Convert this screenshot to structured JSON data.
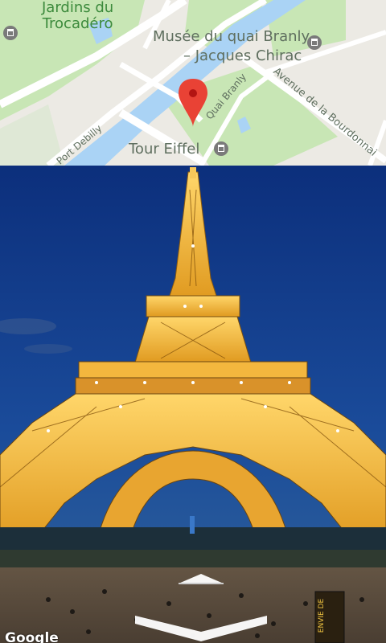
{
  "map": {
    "labels": {
      "jardins": "Jardins du\nTrocadéro",
      "musee_line1": "Musée du quai Branly",
      "musee_line2": "– Jacques Chirac",
      "tour": "Tour Eiffel",
      "quai": "Quai Branly",
      "avenue": "Avenue de la Bourdonnai",
      "port": "Port Debilly"
    },
    "colors": {
      "park": "#c8e6b5",
      "water": "#aad3f5",
      "road": "#ffffff",
      "land": "#eceae4",
      "pin": "#e94235"
    },
    "icons": [
      "museum-icon",
      "museum-icon",
      "location-pin-icon"
    ]
  },
  "street_view": {
    "attribution": "Google",
    "controls": [
      "navigate-forward-arrow",
      "navigate-back-arrow"
    ],
    "sign_text": "ENVIE DE\nL'OMO"
  }
}
